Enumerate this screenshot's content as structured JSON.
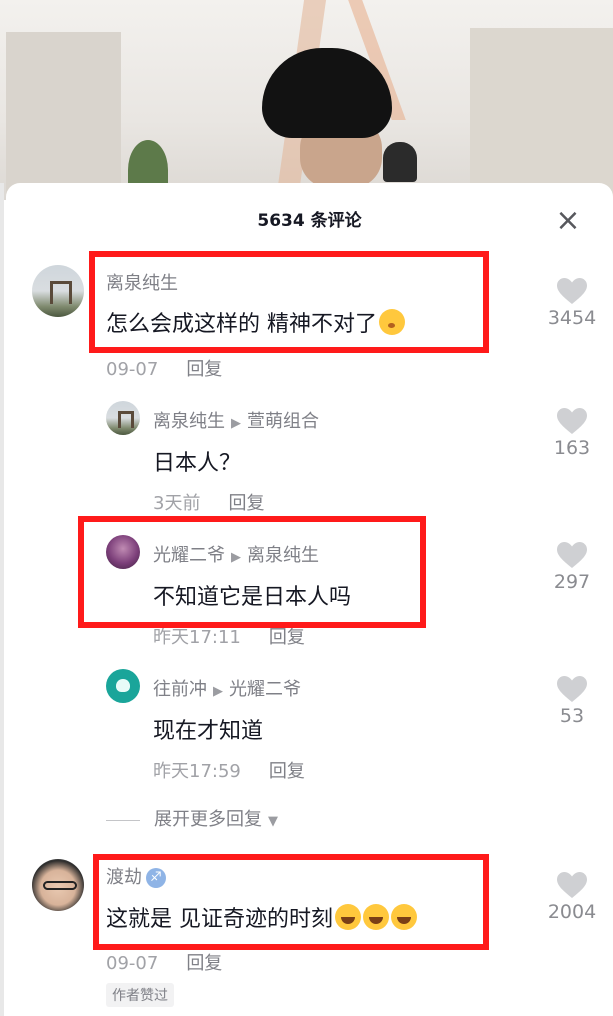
{
  "video": {
    "description_icons": []
  },
  "panel": {
    "title": "5634 条评论",
    "close_icon": "×"
  },
  "comments": [
    {
      "user": "离泉纯生",
      "text": "怎么会成这样的 精神不对了",
      "emoji": "shushing-face-emoji",
      "date": "09-07",
      "reply_label": "回复",
      "likes": "3454"
    },
    {
      "user": "离泉纯生",
      "reply_to": "萱萌组合",
      "text": "日本人？",
      "date": "3天前",
      "reply_label": "回复",
      "likes": "163"
    },
    {
      "user": "光耀二爷",
      "reply_to": "离泉纯生",
      "text": "不知道它是日本人吗",
      "date": "昨天17:11",
      "reply_label": "回复",
      "likes": "297"
    },
    {
      "user": "往前冲",
      "reply_to": "光耀二爷",
      "text": "现在才知道",
      "date": "昨天17:59",
      "reply_label": "回复",
      "likes": "53"
    },
    {
      "user": "渡劫",
      "zodiac": "♐",
      "text": "这就是 见证奇迹的时刻",
      "emoji": "rolling-on-floor-laughing-emoji",
      "date": "09-07",
      "reply_label": "回复",
      "likes": "2004",
      "author_badge": "作者赞过"
    }
  ],
  "expand_more": "展开更多回复",
  "colors": {
    "highlight_box": "#ff1a1a",
    "username": "#7f8087",
    "meta": "#a1a2a7",
    "heart": "#cfd0d3"
  }
}
